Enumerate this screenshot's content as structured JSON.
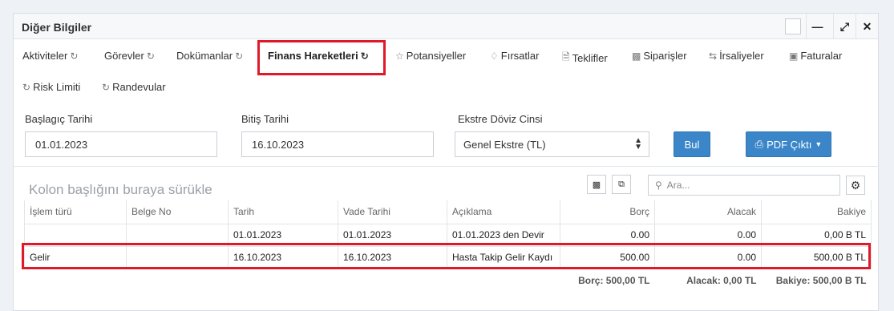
{
  "panel": {
    "title": "Diğer Bilgiler",
    "header_buttons": [
      "minimize-icon",
      "expand-icon",
      "close-icon"
    ]
  },
  "tabs": [
    {
      "label": "Aktiviteler",
      "icon": "refresh-icon"
    },
    {
      "label": "Görevler",
      "icon": "refresh-icon"
    },
    {
      "label": "Dokümanlar",
      "icon": "refresh-icon"
    },
    {
      "label": "Finans Hareketleri",
      "icon": "refresh-icon",
      "active": true
    },
    {
      "label": "Potansiyeller",
      "icon": "star-icon"
    },
    {
      "label": "Fırsatlar",
      "icon": "diamond-icon"
    },
    {
      "label": "Teklifler",
      "icon": "document-icon"
    },
    {
      "label": "Siparişler",
      "icon": "truck-icon"
    },
    {
      "label": "İrsaliyeler",
      "icon": "exchange-icon"
    },
    {
      "label": "Faturalar",
      "icon": "money-icon"
    },
    {
      "label": "Risk Limiti",
      "icon": "refresh-icon"
    },
    {
      "label": "Randevular",
      "icon": "refresh-icon"
    }
  ],
  "filters": {
    "start_label": "Başlagıç Tarihi",
    "start_value": "01.01.2023",
    "end_label": "Bitiş Tarihi",
    "end_value": "16.10.2023",
    "currency_label": "Ekstre Döviz Cinsi",
    "currency_value": "Genel Ekstre (TL)",
    "search_button": "Bul",
    "pdf_button": "PDF Çıktı"
  },
  "grid": {
    "group_hint": "Kolon başlığını buraya sürükle",
    "search_placeholder": "Ara...",
    "columns": [
      "İşlem türü",
      "Belge No",
      "Tarih",
      "Vade Tarihi",
      "Açıklama",
      "Borç",
      "Alacak",
      "Bakiye"
    ],
    "rows": [
      {
        "islem": "",
        "belge": "",
        "tarih": "01.01.2023",
        "vade": "01.01.2023",
        "aciklama": "01.01.2023 den Devir",
        "borc": "0.00",
        "alacak": "0.00",
        "bakiye": "0,00 B TL"
      },
      {
        "islem": "Gelir",
        "belge": "",
        "tarih": "16.10.2023",
        "vade": "16.10.2023",
        "aciklama": "Hasta Takip Gelir Kaydı",
        "borc": "500.00",
        "alacak": "0.00",
        "bakiye": "500,00 B TL"
      }
    ],
    "totals": {
      "borc": "Borç: 500,00 TL",
      "alacak": "Alacak: 0,00 TL",
      "bakiye": "Bakiye: 500,00 B TL"
    }
  },
  "colors": {
    "highlight": "#e0192a",
    "primary_button": "#3a86c8"
  }
}
